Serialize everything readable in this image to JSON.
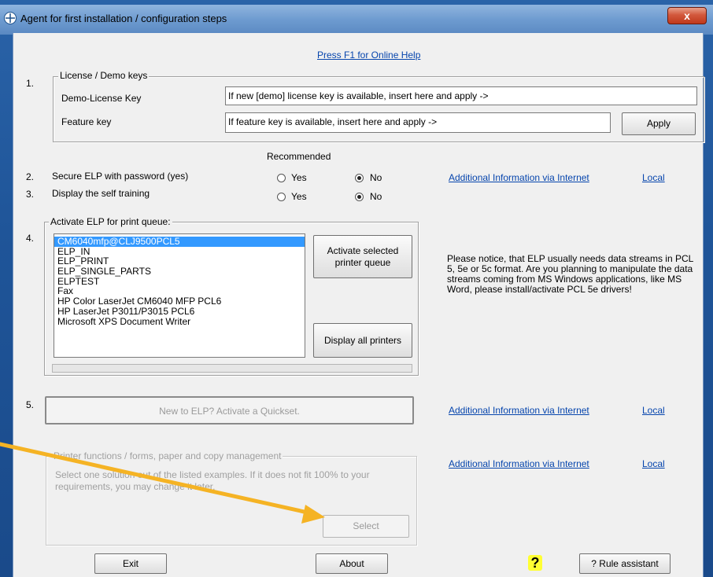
{
  "window": {
    "title": "Agent for first installation / configuration steps",
    "close_label": "x"
  },
  "help_link": "Press F1 for Online Help",
  "sections": {
    "s1": {
      "number": "1.",
      "legend": "License / Demo keys",
      "demo_label": "Demo-License Key",
      "demo_value": "If new [demo] license key is available, insert here and apply ->",
      "feature_label": "Feature key",
      "feature_value": "If feature key is available, insert here and apply ->",
      "apply_label": "Apply"
    },
    "recommended_label": "Recommended",
    "s2": {
      "number": "2.",
      "label": "Secure ELP with password (yes)",
      "yes": "Yes",
      "no": "No",
      "selected": "No",
      "info_link": "Additional Information via Internet",
      "local_link": "Local"
    },
    "s3": {
      "number": "3.",
      "label": "Display the self training",
      "yes": "Yes",
      "no": "No",
      "selected": "No"
    },
    "s4": {
      "number": "4.",
      "legend": "Activate ELP for print queue:",
      "queues": [
        "CM6040mfp@CLJ9500PCL5",
        "ELP_IN",
        "ELP_PRINT",
        "ELP_SINGLE_PARTS",
        "ELPTEST",
        "Fax",
        "HP Color LaserJet CM6040 MFP PCL6",
        "HP LaserJet P3011/P3015 PCL6",
        "Microsoft XPS Document Writer"
      ],
      "selected_queue": "CM6040mfp@CLJ9500PCL5",
      "activate_line1": "Activate selected",
      "activate_line2": "printer queue",
      "display_all_label": "Display all printers",
      "notice": "Please notice, that ELP usually needs data streams in PCL 5, 5e or 5c format. Are you planning to manipulate the data streams coming from MS Windows applications, like MS Word, please install/activate PCL 5e drivers!"
    },
    "s5": {
      "number": "5.",
      "quickset_label": "New to ELP? Activate a Quickset.",
      "info_link": "Additional Information via Internet",
      "local_link": "Local"
    },
    "s6": {
      "legend": "Printer functions / forms, paper and copy management",
      "description": "Select one solution out of the listed examples. If it does not fit 100% to your requirements, you may change it later.",
      "select_label": "Select",
      "info_link": "Additional Information via Internet",
      "local_link": "Local"
    }
  },
  "footer": {
    "exit_label": "Exit",
    "about_label": "About",
    "help_icon_label": "?",
    "rule_label": "? Rule assistant"
  },
  "colors": {
    "arrow": "#f5b324",
    "link": "#0645ad",
    "selection": "#3399ff",
    "help_icon_bg": "#ffff33"
  }
}
